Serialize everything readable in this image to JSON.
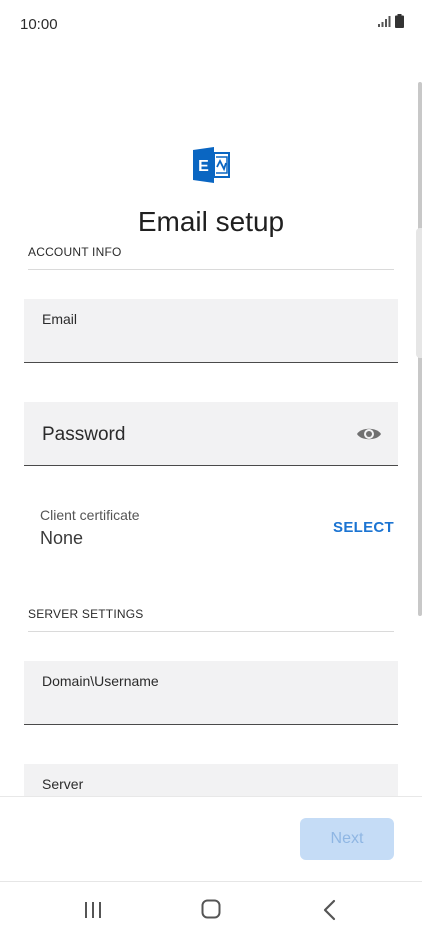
{
  "status_bar": {
    "time": "10:00",
    "signal_icon": "signal-icon",
    "battery_icon": "battery-icon"
  },
  "header": {
    "logo_icon": "exchange-logo-icon",
    "title": "Email setup"
  },
  "account_info": {
    "section_title": "ACCOUNT INFO",
    "email_label": "Email",
    "password_label": "Password",
    "password_toggle_icon": "eye-icon",
    "certificate_label": "Client certificate",
    "certificate_value": "None",
    "select_label": "SELECT"
  },
  "server_settings": {
    "section_title": "SERVER SETTINGS",
    "domain_label": "Domain\\Username",
    "server_label": "Server"
  },
  "footer": {
    "next_label": "Next"
  },
  "nav_bar": {
    "recents_icon": "recents-icon",
    "home_icon": "home-icon",
    "back_icon": "back-icon"
  },
  "colors": {
    "accent": "#1b74d2",
    "field_bg": "#f2f2f3",
    "next_disabled_bg": "#c5dcf6",
    "logo_blue": "#0a66c2"
  }
}
